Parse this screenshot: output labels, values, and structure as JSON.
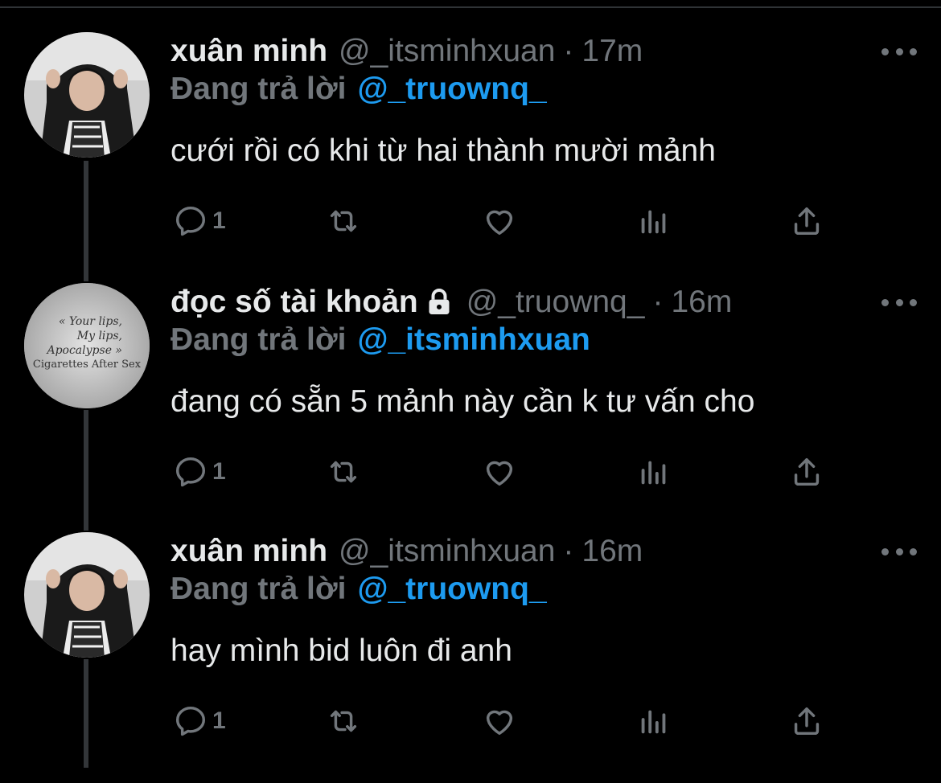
{
  "colors": {
    "background": "#000000",
    "primary_text": "#e7e9ea",
    "secondary_text": "#71767b",
    "accent": "#1d9bf0",
    "thread_line": "#333639"
  },
  "reply_prefix": "Đang trả lời",
  "tweets": [
    {
      "name": "xuân minh",
      "handle": "@_itsminhxuan",
      "separator": "·",
      "time": "17m",
      "replying_to": "@_truownq_",
      "text": "cưới rồi có khi từ hai thành mười mảnh",
      "reply_count": "1",
      "avatar": "photo-of-young-man-in-hoodie",
      "locked": false
    },
    {
      "name": "đọc số tài khoản",
      "handle": "@_truownq_",
      "separator": "·",
      "time": "16m",
      "replying_to": "@_itsminhxuan",
      "text": "đang có sẵn 5 mảnh này cần k tư vấn cho",
      "reply_count": "1",
      "avatar_lines": [
        "« Your lips,",
        "My lips,",
        "Apocalypse »",
        "Cigarettes After Sex"
      ],
      "locked": true
    },
    {
      "name": "xuân minh",
      "handle": "@_itsminhxuan",
      "separator": "·",
      "time": "16m",
      "replying_to": "@_truownq_",
      "text": "hay mình bid luôn đi anh",
      "reply_count": "1",
      "avatar": "photo-of-young-man-in-hoodie",
      "locked": false
    }
  ],
  "icons": [
    "reply-icon",
    "retweet-icon",
    "like-icon",
    "analytics-icon",
    "share-icon",
    "more-icon",
    "lock-icon"
  ]
}
